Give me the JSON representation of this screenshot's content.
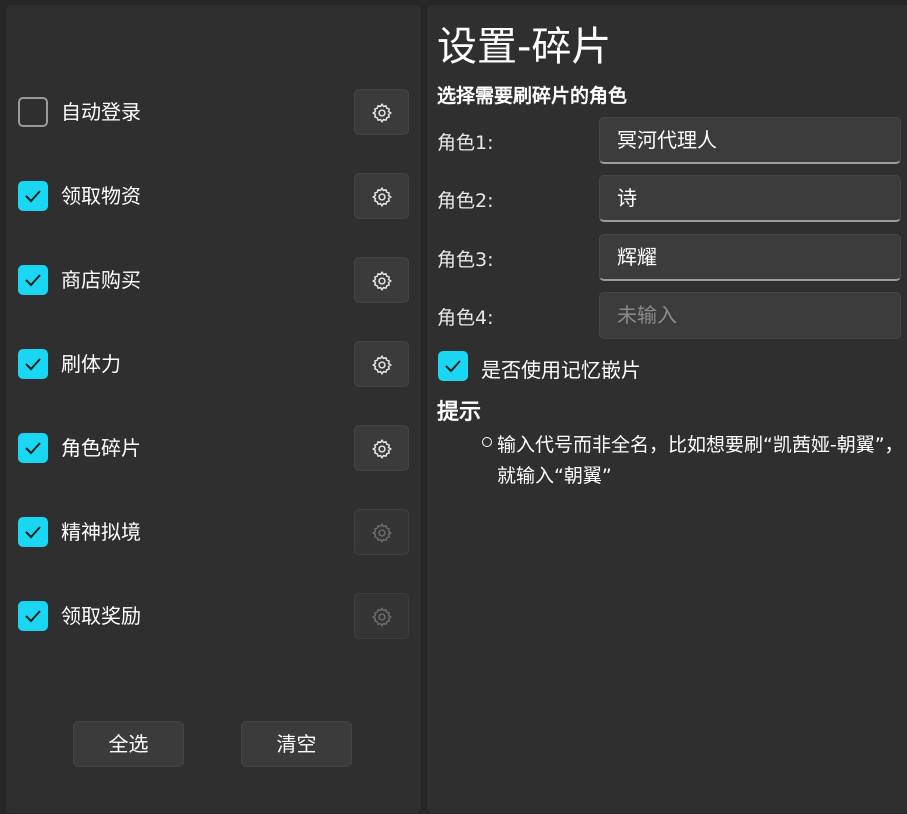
{
  "tasks": [
    {
      "label": "自动登录",
      "checked": false,
      "settings_enabled": true
    },
    {
      "label": "领取物资",
      "checked": true,
      "settings_enabled": true
    },
    {
      "label": "商店购买",
      "checked": true,
      "settings_enabled": true
    },
    {
      "label": "刷体力",
      "checked": true,
      "settings_enabled": true
    },
    {
      "label": "角色碎片",
      "checked": true,
      "settings_enabled": true
    },
    {
      "label": "精神拟境",
      "checked": true,
      "settings_enabled": false
    },
    {
      "label": "领取奖励",
      "checked": true,
      "settings_enabled": false
    }
  ],
  "buttons": {
    "select_all": "全选",
    "clear": "清空"
  },
  "settings": {
    "title": "设置-碎片",
    "subtitle": "选择需要刷碎片的角色",
    "roles": [
      {
        "label": "角色1:",
        "value": "冥河代理人",
        "placeholder": ""
      },
      {
        "label": "角色2:",
        "value": "诗",
        "placeholder": ""
      },
      {
        "label": "角色3:",
        "value": "辉耀",
        "placeholder": ""
      },
      {
        "label": "角色4:",
        "value": "",
        "placeholder": "未输入"
      }
    ],
    "use_memory_label": "是否使用记忆嵌片",
    "use_memory_checked": true,
    "tips_heading": "提示",
    "tip": "输入代号而非全名，比如想要刷“凯茜娅-朝翼”，就输入“朝翼”"
  },
  "colors": {
    "accent": "#19d7f2",
    "panel": "#2f2f2f",
    "background": "#272727"
  },
  "icons": {
    "check": "check-icon",
    "settings": "gear-icon",
    "bullet": "circle-bullet-icon"
  }
}
